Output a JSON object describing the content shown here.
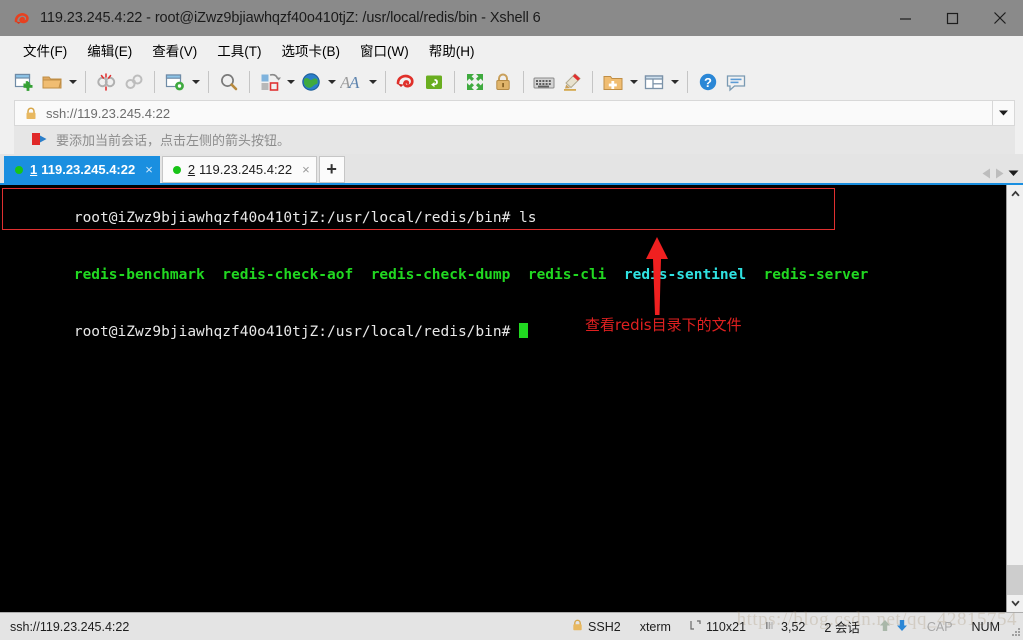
{
  "window": {
    "title": "119.23.245.4:22 - root@iZwz9bjiawhqzf40o410tjZ: /usr/local/redis/bin - Xshell 6",
    "app_icon": "xshell-icon",
    "minimize_label": "—",
    "maximize_label": "☐",
    "close_label": "✕"
  },
  "menubar": {
    "items": [
      {
        "label": "文件(F)",
        "name": "menu-file"
      },
      {
        "label": "编辑(E)",
        "name": "menu-edit"
      },
      {
        "label": "查看(V)",
        "name": "menu-view"
      },
      {
        "label": "工具(T)",
        "name": "menu-tools"
      },
      {
        "label": "选项卡(B)",
        "name": "menu-tabs"
      },
      {
        "label": "窗口(W)",
        "name": "menu-window"
      },
      {
        "label": "帮助(H)",
        "name": "menu-help"
      }
    ]
  },
  "toolbar": {
    "buttons": [
      "new-session-icon",
      "open-folder-icon",
      "disconnect-icon",
      "connect-icon",
      "session-properties-icon",
      "find-icon",
      "transfer-file-icon",
      "globe-icon",
      "font-icon",
      "xftp-icon",
      "xagent-icon",
      "fullscreen-icon",
      "lock-icon",
      "keyboard-icon",
      "highlight-icon",
      "add-folder-icon",
      "layout-icon",
      "help-icon",
      "feedback-icon"
    ]
  },
  "address_bar": {
    "value": "ssh://119.23.245.4:22",
    "lock_icon": "lock-icon",
    "dropdown_icon": "chevron-down-icon"
  },
  "hint_bar": {
    "icon": "arrow-flag-icon",
    "text": "要添加当前会话，点击左侧的箭头按钮。"
  },
  "tabs": {
    "items": [
      {
        "number": "1",
        "label": "119.23.245.4:22",
        "active": true,
        "close": "×"
      },
      {
        "number": "2",
        "label": "119.23.245.4:22",
        "active": false,
        "close": "×"
      }
    ],
    "add_label": "+",
    "scroll_left_icon": "chevron-left-icon",
    "scroll_right_icon": "chevron-right-icon",
    "list_icon": "chevron-down-icon"
  },
  "terminal": {
    "lines": [
      {
        "segments": [
          {
            "text": "root@iZwz9bjiawhqzf40o410tjZ:/usr/local/redis/bin# ls",
            "color": "white"
          }
        ]
      },
      {
        "segments": [
          {
            "text": "redis-benchmark",
            "color": "green"
          },
          {
            "text": "  ",
            "color": "white"
          },
          {
            "text": "redis-check-aof",
            "color": "green"
          },
          {
            "text": "  ",
            "color": "white"
          },
          {
            "text": "redis-check-dump",
            "color": "green"
          },
          {
            "text": "  ",
            "color": "white"
          },
          {
            "text": "redis-cli",
            "color": "green"
          },
          {
            "text": "  ",
            "color": "white"
          },
          {
            "text": "redis-sentinel",
            "color": "cyan"
          },
          {
            "text": "  ",
            "color": "white"
          },
          {
            "text": "redis-server",
            "color": "green"
          }
        ]
      },
      {
        "segments": [
          {
            "text": "root@iZwz9bjiawhqzf40o410tjZ:/usr/local/redis/bin# ",
            "color": "white"
          }
        ],
        "cursor": true
      }
    ],
    "annotation": {
      "text": "查看redis目录下的文件",
      "color": "#e02020",
      "arrow": "up-arrow"
    },
    "colors": {
      "background": "#000000",
      "foreground": "#e6e6e6",
      "green": "#21d821",
      "cyan": "#2fe2e2",
      "annotation_red": "#e02020"
    }
  },
  "statusbar": {
    "url": "ssh://119.23.245.4:22",
    "protocol": "SSH2",
    "emulation": "xterm",
    "size": "110x21",
    "cursor_pos": "3,52",
    "sessions": "2 会话",
    "cap": "CAP",
    "num": "NUM",
    "lock_icon": "lock-icon",
    "upload_icon": "arrow-up-icon",
    "download_icon": "arrow-down-icon",
    "watermark": "https://blog.csdn.net/qq_42815754"
  }
}
